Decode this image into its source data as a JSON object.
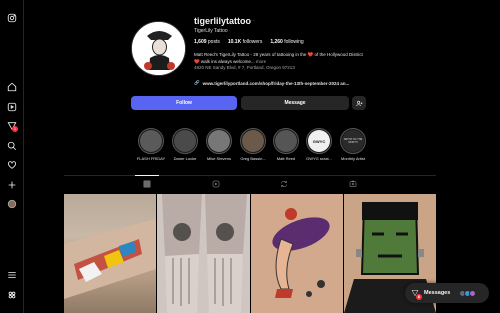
{
  "profile": {
    "username": "tigerlilytattoo",
    "full_name": "TigerLily Tattoo",
    "posts": "1,609",
    "posts_label": "posts",
    "followers": "10.1K",
    "followers_label": "followers",
    "following": "1,260",
    "following_label": "following",
    "bio_line1": "Matt Reed's TigerLily Tattoo - 28 years of tattooing in the ❤️ of the Hollywood District",
    "bio_line2": "❤️ walk ins always welcome...",
    "bio_more": "more",
    "address": "4820 NE Sandy Blvd, # 7, Portland, Oregon 97213",
    "link": "www.tigerlilyportland.com/shop/friday-the-13th-september-2024 an..."
  },
  "buttons": {
    "follow": "Follow",
    "message": "Message",
    "add": "+"
  },
  "highlights": [
    {
      "label": "FLASH FRIDAY",
      "color": "#5a5a5a"
    },
    {
      "label": "Daner Locke",
      "color": "#4a4a4a"
    },
    {
      "label": "Mike Stevens",
      "color": "#777777"
    },
    {
      "label": "Greg Bassin...",
      "color": "#6b5a4a"
    },
    {
      "label": "Matt Reed",
      "color": "#555555"
    },
    {
      "label": "GWYG scrat...",
      "color": "#f0f0f0",
      "text": "GWYC"
    },
    {
      "label": "Monthly Artist",
      "color": "#2a2a2a",
      "text": "ARTIST OF THE MONTH"
    }
  ],
  "messages": {
    "label": "Messages",
    "badge": "6"
  },
  "nav": {
    "notifications_badge": "1"
  },
  "colors": {
    "accent": "#5865f2",
    "badge": "#ff3040",
    "surface": "#262626"
  }
}
